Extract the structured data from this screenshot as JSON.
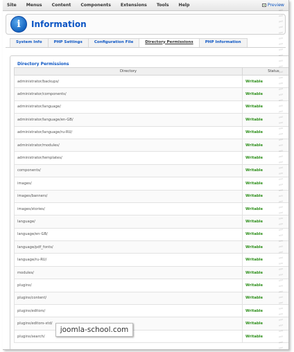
{
  "menubar": {
    "items": [
      "Site",
      "Menus",
      "Content",
      "Components",
      "Extensions",
      "Tools",
      "Help"
    ],
    "preview": "Preview"
  },
  "header": {
    "title": "Information",
    "icon": "info-icon"
  },
  "tabs": [
    "System Info",
    "PHP Settings",
    "Configuration File",
    "Directory Permissions",
    "PHP Information"
  ],
  "active_tab": "Directory Permissions",
  "panel": {
    "legend": "Directory Permissions",
    "columns": {
      "directory": "Directory",
      "status": "Status"
    },
    "rows": [
      {
        "dir": "administrator/backups/",
        "status": "Writable"
      },
      {
        "dir": "administrator/components/",
        "status": "Writable"
      },
      {
        "dir": "administrator/language/",
        "status": "Writable"
      },
      {
        "dir": "administrator/language/en-GB/",
        "status": "Writable"
      },
      {
        "dir": "administrator/language/ru-RU/",
        "status": "Writable"
      },
      {
        "dir": "administrator/modules/",
        "status": "Writable"
      },
      {
        "dir": "administrator/templates/",
        "status": "Writable"
      },
      {
        "dir": "components/",
        "status": "Writable"
      },
      {
        "dir": "images/",
        "status": "Writable"
      },
      {
        "dir": "images/banners/",
        "status": "Writable"
      },
      {
        "dir": "images/stories/",
        "status": "Writable"
      },
      {
        "dir": "language/",
        "status": "Writable"
      },
      {
        "dir": "language/en-GB/",
        "status": "Writable"
      },
      {
        "dir": "language/pdf_fonts/",
        "status": "Writable"
      },
      {
        "dir": "language/ru-RU/",
        "status": "Writable"
      },
      {
        "dir": "modules/",
        "status": "Writable"
      },
      {
        "dir": "plugins/",
        "status": "Writable"
      },
      {
        "dir": "plugins/content/",
        "status": "Writable"
      },
      {
        "dir": "plugins/editors/",
        "status": "Writable"
      },
      {
        "dir": "plugins/editors-xtd/",
        "status": "Writable"
      },
      {
        "dir": "plugins/search/",
        "status": "Writable"
      }
    ]
  },
  "watermark": "joomla-school.com",
  "colors": {
    "link": "#0b55c4",
    "writable": "#2d8f1a"
  }
}
